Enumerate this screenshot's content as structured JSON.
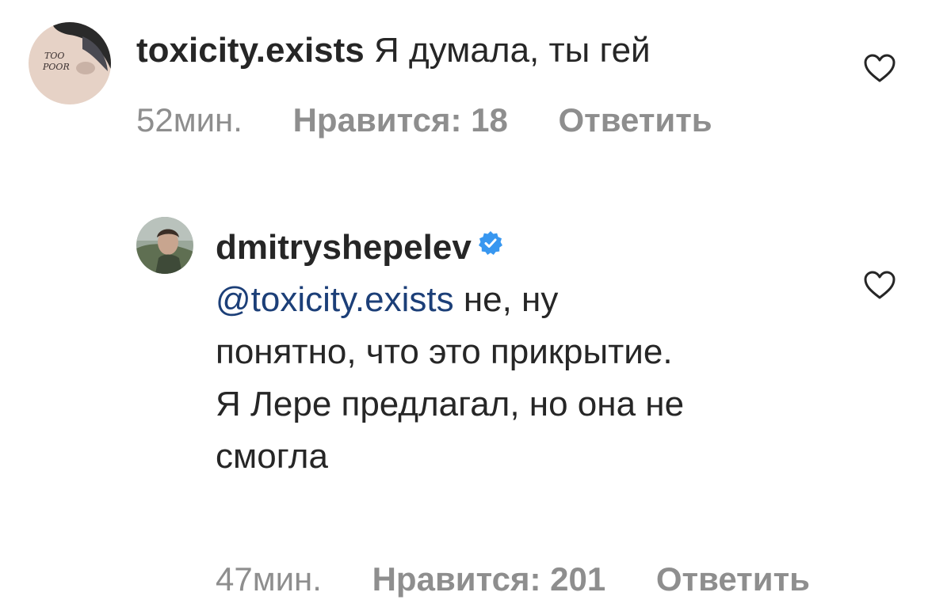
{
  "comments": [
    {
      "username": "toxicity.exists",
      "verified": false,
      "mention": "",
      "text": "Я думала, ты гей",
      "time": "52мин.",
      "likes": "Нравится: 18",
      "reply": "Ответить",
      "avatar_text": [
        "TOO",
        "POOR"
      ]
    },
    {
      "username": "dmitryshepelev",
      "verified": true,
      "mention": "@toxicity.exists",
      "text": "не, ну понятно, что это прикрытие. Я Лере предлагал, но она не смогла",
      "time": "47мин.",
      "likes": "Нравится: 201",
      "reply": "Ответить"
    }
  ],
  "colors": {
    "text": "#262626",
    "meta": "#8e8e8e",
    "mention": "#1c3f78",
    "verified": "#3897f0"
  },
  "icons": {
    "like": "heart-outline-icon",
    "verified": "verified-badge-icon"
  }
}
